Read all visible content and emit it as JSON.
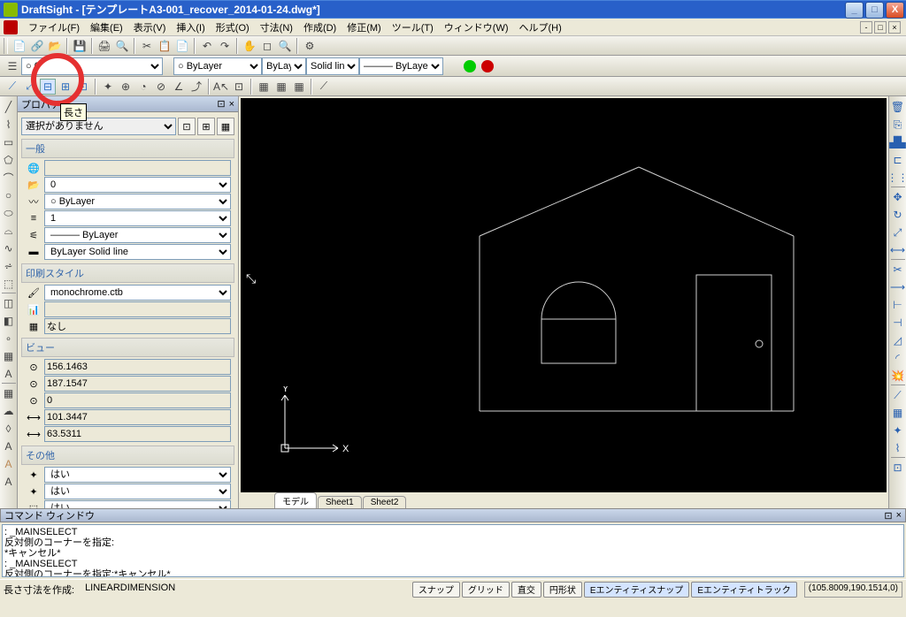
{
  "window": {
    "title": "DraftSight - [テンプレートA3-001_recover_2014-01-24.dwg*]"
  },
  "menu": {
    "file": "ファイル(F)",
    "edit": "編集(E)",
    "view": "表示(V)",
    "insert": "挿入(I)",
    "format": "形式(O)",
    "dim": "寸法(N)",
    "draw": "作成(D)",
    "modify": "修正(M)",
    "tools": "ツール(T)",
    "window": "ウィンドウ(W)",
    "help": "ヘルプ(H)"
  },
  "layer_row": {
    "layer": "0",
    "color": "ByLayer",
    "line": "ByLayer",
    "style": "Solid line",
    "lw": "ByLayer"
  },
  "tooltip": "長さ",
  "properties": {
    "title": "プロパティ",
    "no_selection": "選択がありません",
    "section_general": "一般",
    "layer": "0",
    "color": "○ ByLayer",
    "scale": "1",
    "linetype": "ByLayer",
    "ltype2": "ByLayer     Solid line",
    "section_print": "印刷スタイル",
    "printstyle": "monochrome.ctb",
    "none": "なし",
    "section_view": "ビュー",
    "vx": "156.1463",
    "vy": "187.1547",
    "vz": "0",
    "vh": "101.3447",
    "vw": "63.5311",
    "section_other": "その他",
    "o1": "はい",
    "o2": "はい",
    "o3": "はい"
  },
  "tabs": {
    "model": "モデル",
    "s1": "Sheet1",
    "s2": "Sheet2"
  },
  "cmd": {
    "title": "コマンド ウィンドウ",
    "l1": ": _MAINSELECT",
    "l2": "反対側のコーナーを指定:",
    "l3": "*キャンセル*",
    "l4": ": _MAINSELECT",
    "l5": "反対側のコーナーを指定:*キャンセル*"
  },
  "status": {
    "left1": "長さ寸法を作成:",
    "left2": "LINEARDIMENSION",
    "snap": "スナップ",
    "grid": "グリッド",
    "ortho": "直交",
    "polar": "円形状",
    "esnap": "Eエンティティスナップ",
    "etrack": "Eエンティティトラック",
    "coords": "(105.8009,190.1514,0)"
  }
}
